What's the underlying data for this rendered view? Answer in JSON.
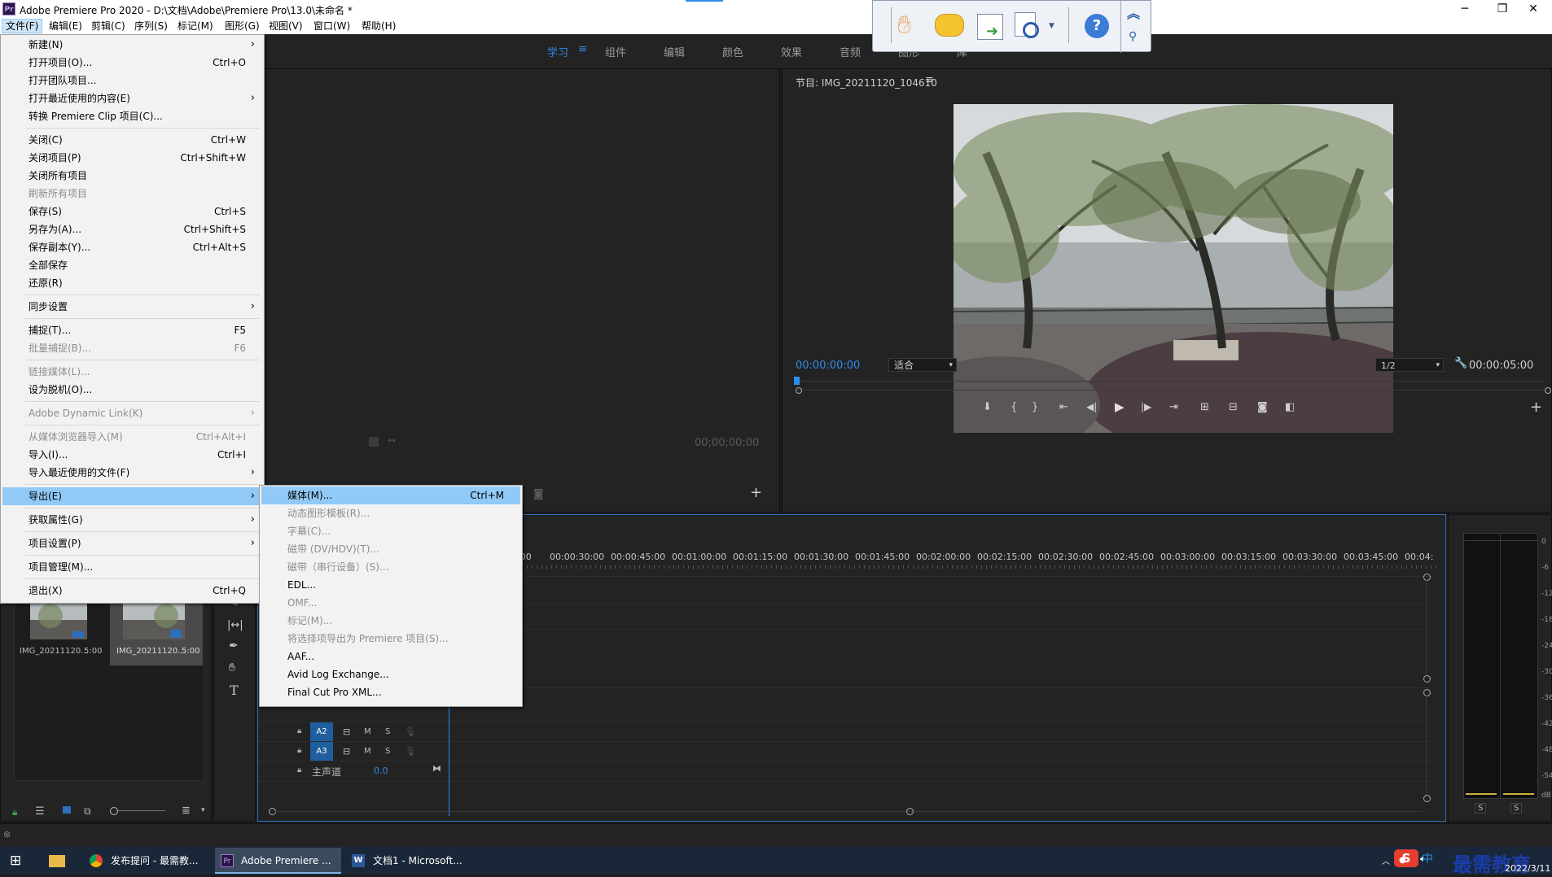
{
  "window": {
    "title": "Adobe Premiere Pro 2020 - D:\\文档\\Adobe\\Premiere Pro\\13.0\\未命名 *",
    "app_icon": "Pr"
  },
  "menubar": [
    "文件(F)",
    "编辑(E)",
    "剪辑(C)",
    "序列(S)",
    "标记(M)",
    "图形(G)",
    "视图(V)",
    "窗口(W)",
    "帮助(H)"
  ],
  "workspace_tabs": [
    "学习",
    "组件",
    "编辑",
    "颜色",
    "效果",
    "音频",
    "图形",
    "库"
  ],
  "file_menu": [
    {
      "label": "新建(N)",
      "submenu": true
    },
    {
      "label": "打开项目(O)...",
      "shortcut": "Ctrl+O"
    },
    {
      "label": "打开团队项目..."
    },
    {
      "label": "打开最近使用的内容(E)",
      "submenu": true
    },
    {
      "label": "转换 Premiere Clip 项目(C)..."
    },
    {
      "label": "关闭(C)",
      "shortcut": "Ctrl+W"
    },
    {
      "label": "关闭项目(P)",
      "shortcut": "Ctrl+Shift+W"
    },
    {
      "label": "关闭所有项目"
    },
    {
      "label": "刷新所有项目",
      "disabled": true
    },
    {
      "label": "保存(S)",
      "shortcut": "Ctrl+S"
    },
    {
      "label": "另存为(A)...",
      "shortcut": "Ctrl+Shift+S"
    },
    {
      "label": "保存副本(Y)...",
      "shortcut": "Ctrl+Alt+S"
    },
    {
      "label": "全部保存"
    },
    {
      "label": "还原(R)"
    },
    {
      "label": "同步设置",
      "submenu": true
    },
    {
      "label": "捕捉(T)...",
      "shortcut": "F5"
    },
    {
      "label": "批量捕捉(B)...",
      "shortcut": "F6",
      "disabled": true
    },
    {
      "label": "链接媒体(L)...",
      "disabled": true
    },
    {
      "label": "设为脱机(O)..."
    },
    {
      "label": "Adobe Dynamic Link(K)",
      "submenu": true,
      "disabled": true
    },
    {
      "label": "从媒体浏览器导入(M)",
      "shortcut": "Ctrl+Alt+I",
      "disabled": true
    },
    {
      "label": "导入(I)...",
      "shortcut": "Ctrl+I"
    },
    {
      "label": "导入最近使用的文件(F)",
      "submenu": true
    },
    {
      "label": "导出(E)",
      "submenu": true,
      "highlighted": true
    },
    {
      "label": "获取属性(G)",
      "submenu": true
    },
    {
      "label": "项目设置(P)",
      "submenu": true
    },
    {
      "label": "项目管理(M)..."
    },
    {
      "label": "退出(X)",
      "shortcut": "Ctrl+Q"
    }
  ],
  "export_submenu": [
    {
      "label": "媒体(M)...",
      "shortcut": "Ctrl+M",
      "highlighted": true
    },
    {
      "label": "动态图形模板(R)...",
      "disabled": true
    },
    {
      "label": "字幕(C)...",
      "disabled": true
    },
    {
      "label": "磁带 (DV/HDV)(T)...",
      "disabled": true
    },
    {
      "label": "磁带（串行设备）(S)...",
      "disabled": true
    },
    {
      "label": "EDL..."
    },
    {
      "label": "OMF...",
      "disabled": true
    },
    {
      "label": "标记(M)...",
      "disabled": true
    },
    {
      "label": "将选择项导出为 Premiere 项目(S)...",
      "disabled": true
    },
    {
      "label": "AAF..."
    },
    {
      "label": "Avid Log Exchange..."
    },
    {
      "label": "Final Cut Pro XML..."
    }
  ],
  "source_monitor": {
    "timecode": "00;00;00;00"
  },
  "program_monitor": {
    "title": "节目: IMG_20211120_104610",
    "timecode_current": "00:00:00:00",
    "fit": "适合",
    "resolution": "1/2",
    "timecode_duration": "00:00:05:00"
  },
  "project_panel": {
    "clips": [
      {
        "name": "IMG_20211120...",
        "duration": "5:00"
      },
      {
        "name": "IMG_20211120...",
        "duration": "5:00"
      }
    ]
  },
  "timeline": {
    "ruler": [
      ":00",
      "00:00:30:00",
      "00:00:45:00",
      "00:01:00:00",
      "00:01:15:00",
      "00:01:30:00",
      "00:01:45:00",
      "00:02:00:00",
      "00:02:15:00",
      "00:02:30:00",
      "00:02:45:00",
      "00:03:00:00",
      "00:03:15:00",
      "00:03:30:00",
      "00:03:45:00",
      "00:04:"
    ],
    "audio_tracks": [
      {
        "name": "A2",
        "m": "M",
        "s": "S"
      },
      {
        "name": "A3",
        "m": "M",
        "s": "S"
      }
    ],
    "master": {
      "label": "主声道",
      "value": "0.0"
    }
  },
  "audio_meter": {
    "scale": [
      "0",
      "-6",
      "-12",
      "-18",
      "-24",
      "-30",
      "-36",
      "-42",
      "-48",
      "-54",
      "dB"
    ],
    "solo": [
      "S",
      "S"
    ]
  },
  "taskbar": {
    "items": [
      "发布提问 - 最需教...",
      "Adobe Premiere ...",
      "文档1 - Microsoft..."
    ],
    "ime": "中",
    "date": "2022/3/11",
    "watermark": "最需教育"
  },
  "colors": {
    "accent": "#2d8ceb",
    "menu_highlight": "#91c9f7",
    "timeline_playhead": "#2d8ceb"
  }
}
